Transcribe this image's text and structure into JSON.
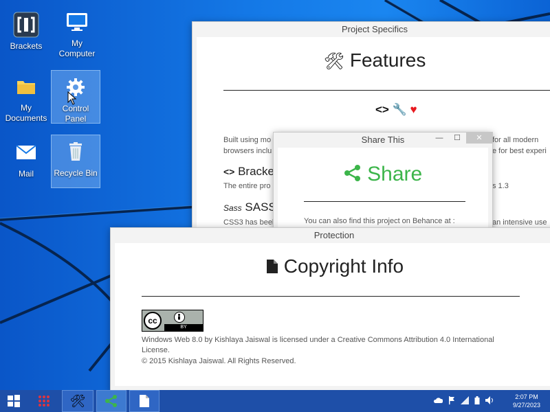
{
  "desktop_icons": [
    {
      "label": "Brackets"
    },
    {
      "label": "My Computer"
    },
    {
      "label": "My Documents"
    },
    {
      "label": "Control Panel"
    },
    {
      "label": "Mail"
    },
    {
      "label": "Recycle Bin"
    }
  ],
  "windows": {
    "project": {
      "title": "Project Specifics",
      "heading": "Features",
      "intro_line1_left": "Built using mo",
      "intro_line1_right": "for all modern",
      "intro_line2_left": "browsers inclu",
      "intro_line2_right": "e for best experi",
      "section1_title": "Bracke",
      "section1_text_left": "The entire pro",
      "section1_text_right": "s 1.3",
      "section2_title": "SASS F",
      "section2_text_left": "CSS3 has beel",
      "section2_text_right": "an intensive use"
    },
    "share": {
      "title": "Share This",
      "heading": "Share",
      "text": "You can also find this project on Behance at :"
    },
    "protection": {
      "title": "Protection",
      "heading": "Copyright Info",
      "license_line1": "Windows Web 8.0 by Kishlaya Jaiswal is licensed under a Creative Commons Attribution 4.0 International",
      "license_line2": "License.",
      "copyright": "© 2015 Kishlaya Jaiswal. All Rights Reserved.",
      "badge_text": "BY"
    }
  },
  "taskbar": {
    "time": "2:07 PM",
    "date": "9/27/2023"
  },
  "colors": {
    "accent_green": "#3cb54a",
    "taskbar": "#1e4fa8",
    "heart": "#e8191f"
  }
}
